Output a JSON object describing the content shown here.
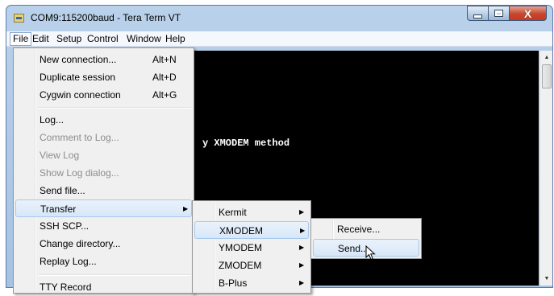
{
  "window": {
    "title": "COM9:115200baud - Tera Term VT",
    "minimize_glyph": "",
    "close_glyph": "X"
  },
  "menubar": [
    {
      "label": "File",
      "active": true
    },
    {
      "label": "Edit"
    },
    {
      "label": "Setup"
    },
    {
      "label": "Control"
    },
    {
      "label": "Window"
    },
    {
      "label": "Help"
    }
  ],
  "terminal": {
    "text": "y XMODEM method",
    "background": "#000000",
    "foreground": "#ffffff"
  },
  "file_menu": {
    "items": [
      {
        "label": "New connection...",
        "shortcut": "Alt+N"
      },
      {
        "label": "Duplicate session",
        "shortcut": "Alt+D"
      },
      {
        "label": "Cygwin connection",
        "shortcut": "Alt+G"
      },
      {
        "label": "Log..."
      },
      {
        "label": "Comment to Log...",
        "disabled": true
      },
      {
        "label": "View Log",
        "disabled": true
      },
      {
        "label": "Show Log dialog...",
        "disabled": true
      },
      {
        "label": "Send file..."
      },
      {
        "label": "Transfer",
        "submenu": true,
        "highlighted": true
      },
      {
        "label": "SSH SCP..."
      },
      {
        "label": "Change directory..."
      },
      {
        "label": "Replay Log..."
      },
      {
        "label": "TTY Record"
      }
    ]
  },
  "transfer_menu": {
    "items": [
      {
        "label": "Kermit",
        "submenu": true
      },
      {
        "label": "XMODEM",
        "submenu": true,
        "highlighted": true
      },
      {
        "label": "YMODEM",
        "submenu": true
      },
      {
        "label": "ZMODEM",
        "submenu": true
      },
      {
        "label": "B-Plus",
        "submenu": true
      }
    ]
  },
  "xmodem_menu": {
    "items": [
      {
        "label": "Receive..."
      },
      {
        "label": "Send...",
        "highlighted": true
      }
    ]
  },
  "colors": {
    "highlight_border": "#a8c8ea",
    "menu_background": "#f0f0f0"
  },
  "icons": {
    "submenu_arrow": "triangle-right",
    "app": "tera-term-app-icon",
    "cursor": "mouse-pointer"
  }
}
